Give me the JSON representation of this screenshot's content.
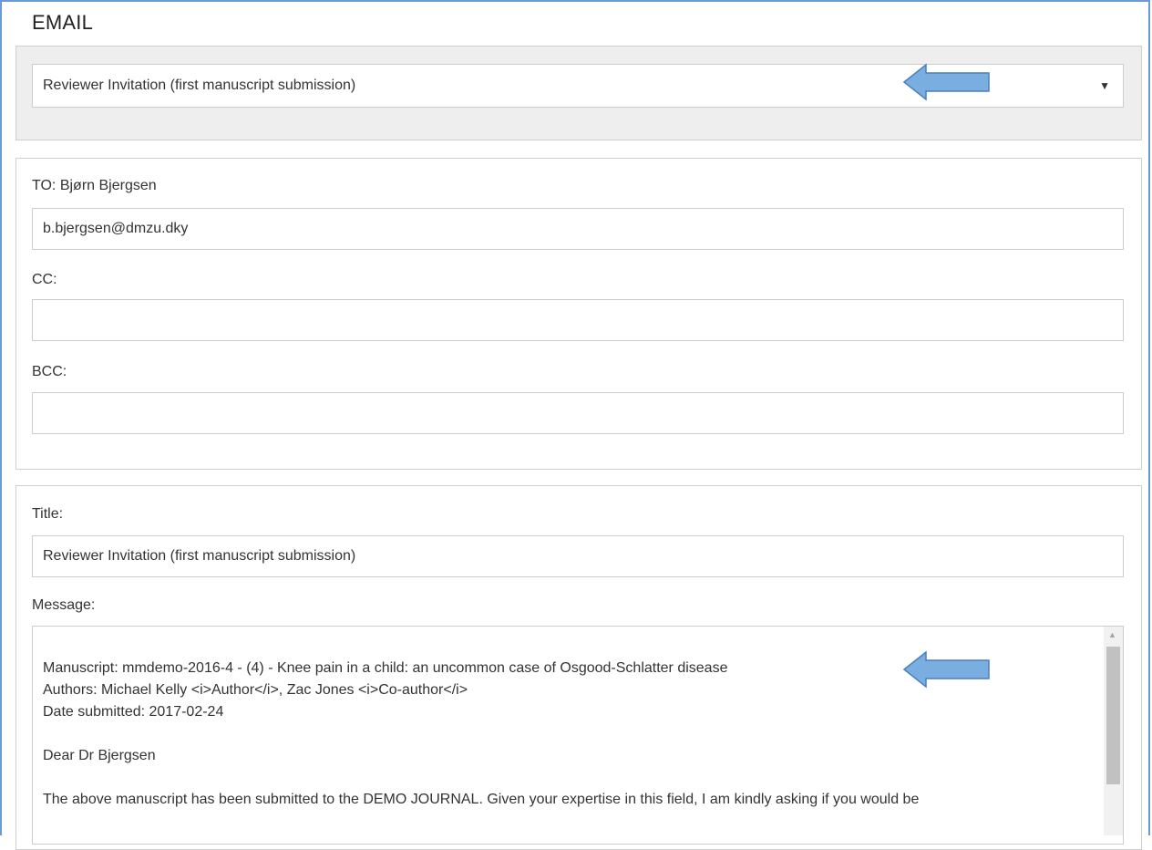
{
  "section_title": "EMAIL",
  "template_select": {
    "value": "Reviewer Invitation (first manuscript submission)"
  },
  "to": {
    "label": "TO: Bjørn Bjergsen",
    "value": "b.bjergsen@dmzu.dky"
  },
  "cc": {
    "label": "CC:",
    "value": ""
  },
  "bcc": {
    "label": "BCC:",
    "value": ""
  },
  "title_field": {
    "label": "Title:",
    "value": "Reviewer Invitation (first manuscript submission)"
  },
  "message": {
    "label": "Message:",
    "lines": [
      "Manuscript: mmdemo-2016-4 - (4) - Knee pain in a child: an uncommon case of Osgood-Schlatter disease",
      "Authors: Michael Kelly <i>Author</i>, Zac Jones <i>Co-author</i>",
      "Date submitted: 2017-02-24",
      "Dear Dr Bjergsen",
      "The above manuscript has been submitted to the DEMO JOURNAL. Given your expertise in this field, I am kindly asking if you would be"
    ]
  },
  "colors": {
    "arrow_fill": "#7aaee0",
    "arrow_stroke": "#4a7fbe",
    "frame_border": "#6b9ad6"
  },
  "icons": {
    "dropdown": "caret-down-icon",
    "pointer": "left-arrow-icon"
  }
}
